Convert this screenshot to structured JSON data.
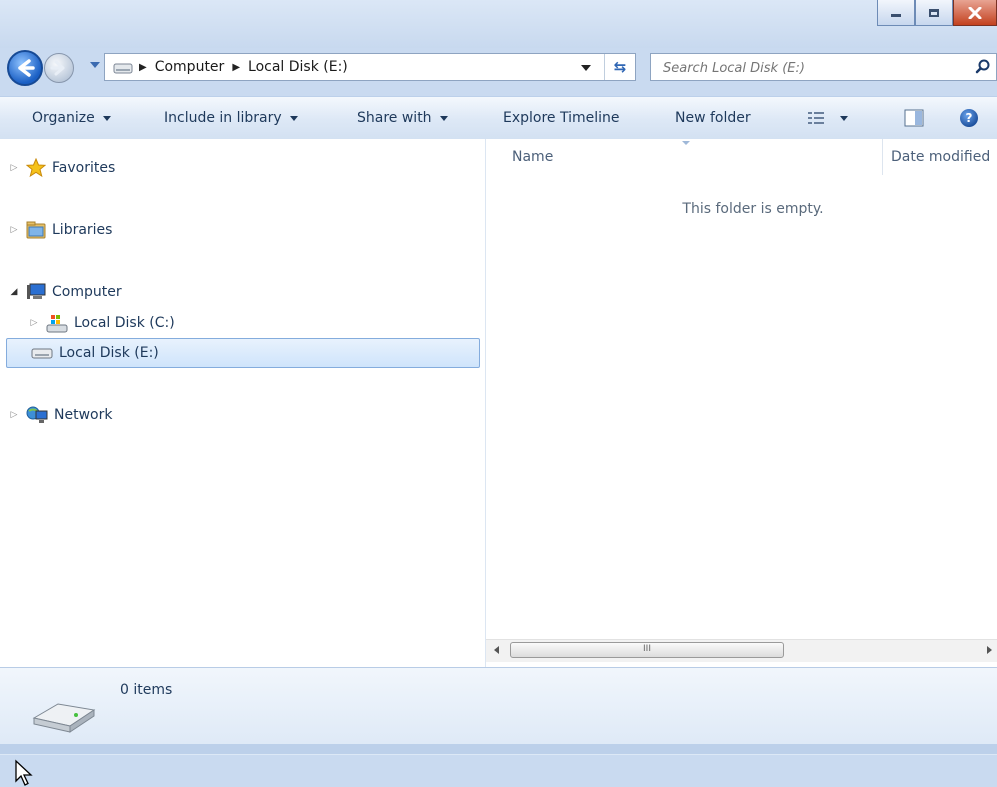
{
  "window": {
    "minimize_icon": "minimize-icon",
    "maximize_icon": "maximize-icon",
    "close_icon": "close-icon"
  },
  "address_bar": {
    "crumbs": [
      "Computer",
      "Local Disk (E:)"
    ],
    "separator": "▶",
    "refresh_glyph": "⇆"
  },
  "search": {
    "placeholder": "Search Local Disk (E:)"
  },
  "toolbar": {
    "organize": "Organize",
    "include_in_library": "Include in library",
    "share_with": "Share with",
    "explore_timeline": "Explore Timeline",
    "new_folder": "New folder",
    "help_glyph": "?"
  },
  "nav": {
    "favorites": "Favorites",
    "libraries": "Libraries",
    "computer": "Computer",
    "local_disk_c": "Local Disk (C:)",
    "local_disk_e": "Local Disk (E:)",
    "network": "Network",
    "collapsed_glyph": "▷",
    "expanded_glyph": "◢"
  },
  "content": {
    "col_name": "Name",
    "col_date": "Date modified",
    "empty_message": "This folder is empty.",
    "scroll_grip": "III"
  },
  "details": {
    "count": "0 items"
  },
  "colors": {
    "chrome": "#c9daf0",
    "selection_border": "#84acdd",
    "close_button": "#c3411f"
  }
}
